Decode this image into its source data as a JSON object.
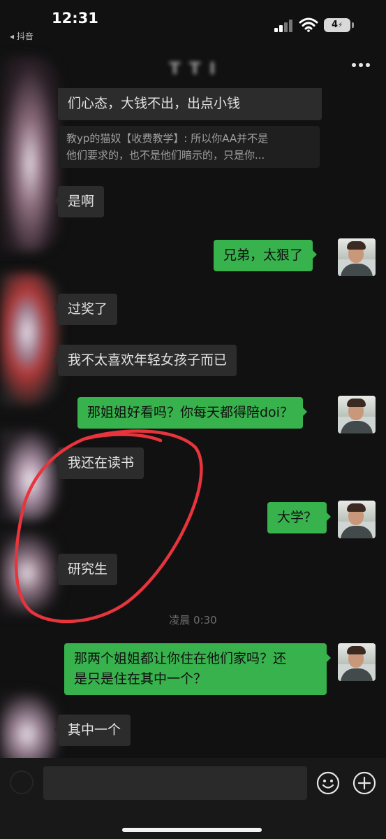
{
  "status_bar": {
    "time": "12:31",
    "back_app": "◂ 抖音",
    "battery": "4"
  },
  "header": {
    "title": "T T I"
  },
  "messages": [
    {
      "side": "in",
      "text": "们心态，大钱不出，出点小钱"
    },
    {
      "side": "in",
      "quote_line1": "教yp的猫奴【收费教学】: 所以你AA并不是",
      "quote_line2": "他们要求的，也不是他们暗示的，只是你..."
    },
    {
      "side": "in",
      "text": "是啊"
    },
    {
      "side": "out",
      "text": "兄弟，太狠了"
    },
    {
      "side": "in",
      "text": "过奖了"
    },
    {
      "side": "in",
      "text": "我不太喜欢年轻女孩子而已"
    },
    {
      "side": "out",
      "text": "那姐姐好看吗？你每天都得陪doi？"
    },
    {
      "side": "in",
      "text": "我还在读书"
    },
    {
      "side": "out",
      "text": "大学？"
    },
    {
      "side": "in",
      "text": "研究生"
    },
    {
      "side": "out",
      "line1": "那两个姐姐都让你住在他们家吗？还",
      "line2": "是只是住在其中一个？"
    },
    {
      "side": "in",
      "text": "其中一个"
    }
  ],
  "time_separator": "凌晨 0:30",
  "colors": {
    "outgoing_bubble": "#37b24d",
    "incoming_bubble": "#2c2c2c",
    "annotation": "#e8343c"
  }
}
